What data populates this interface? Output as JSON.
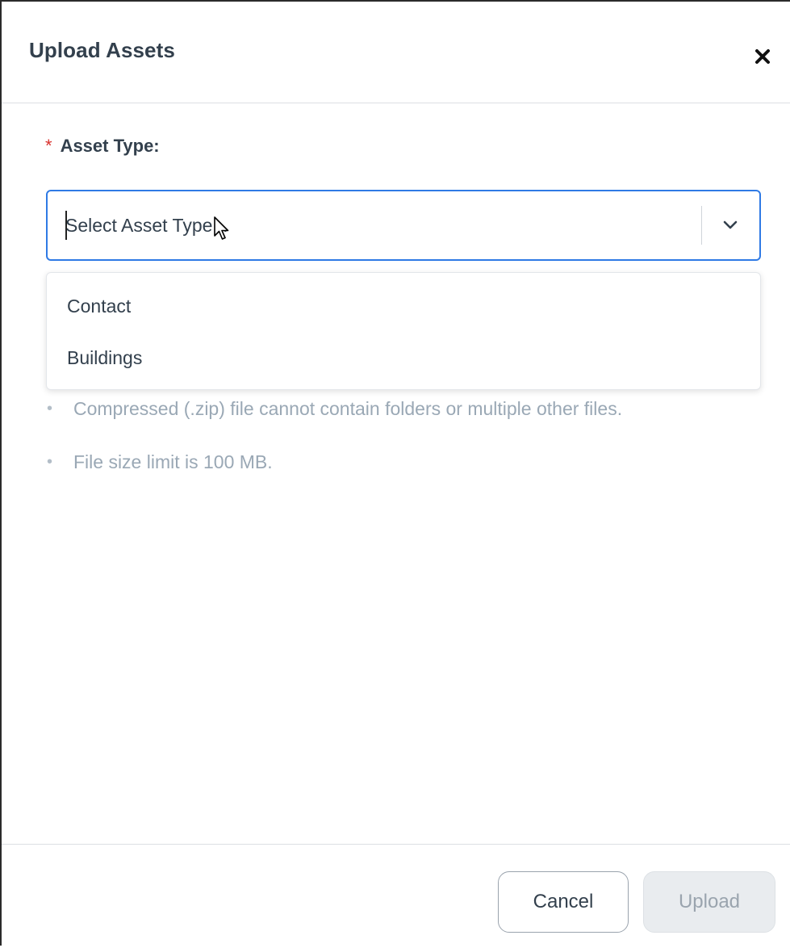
{
  "dialog": {
    "title": "Upload Assets",
    "close_icon": "close-icon"
  },
  "field": {
    "required_marker": "*",
    "label": "Asset Type:",
    "placeholder": "Select Asset Type...",
    "chevron_icon": "chevron-down-icon",
    "accent_color": "#2f7ae5"
  },
  "dropdown": {
    "options": [
      "Contact",
      "Buildings"
    ]
  },
  "notes": [
    "Compressed (.zip) file cannot contain folders or multiple other files.",
    "File size limit is 100 MB."
  ],
  "footer": {
    "cancel_label": "Cancel",
    "upload_label": "Upload"
  }
}
